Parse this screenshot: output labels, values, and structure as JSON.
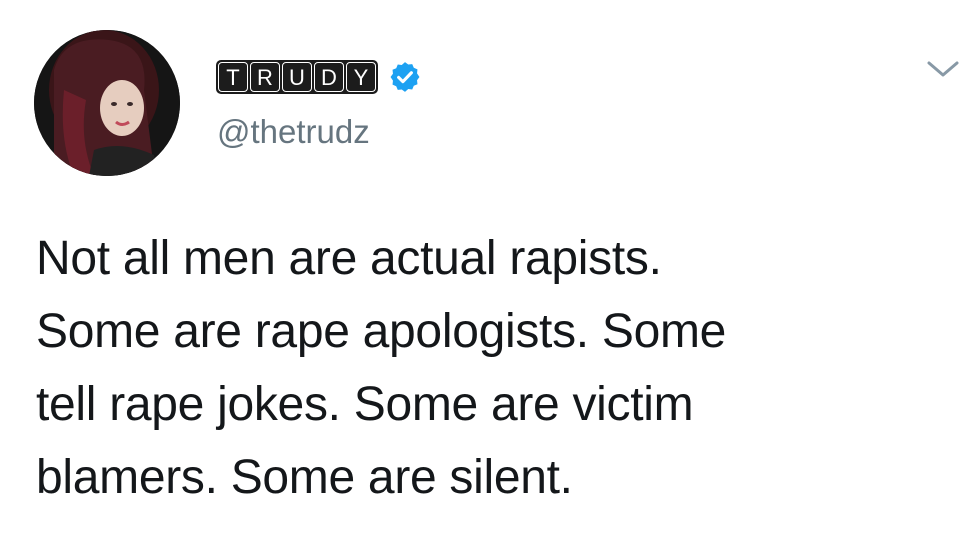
{
  "author": {
    "display_name_letters": [
      "T",
      "R",
      "U",
      "D",
      "Y"
    ],
    "handle": "@thetrudz",
    "verified": true,
    "avatar_icon": "profile-photo"
  },
  "tweet": {
    "lines": [
      "Not all men are actual rapists.",
      "Some are rape apologists. Some",
      "tell rape jokes. Some are victim",
      "blamers. Some are silent."
    ]
  },
  "icons": {
    "verified": "verified-badge-icon",
    "menu": "chevron-down-icon"
  },
  "colors": {
    "verified_blue": "#1da1f2",
    "handle_gray": "#66757f",
    "text": "#14171a",
    "chevron_gray": "#8899a6"
  }
}
